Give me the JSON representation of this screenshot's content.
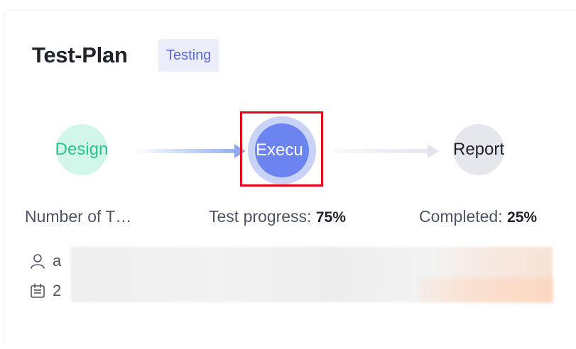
{
  "plan": {
    "title": "Test-Plan",
    "status_badge": "Testing"
  },
  "stages": [
    {
      "label": "Design",
      "color": "#2ec38b"
    },
    {
      "label": "Execu",
      "color": "#6c84f0"
    },
    {
      "label": "Report",
      "color": "#1f2329"
    }
  ],
  "stats": {
    "number_label": "Number of T…",
    "progress_label": "Test progress: ",
    "progress_value": "75%",
    "completed_label": "Completed: ",
    "completed_value": "25%"
  },
  "meta": {
    "user_text": "a",
    "date_text": "2"
  },
  "icons": {
    "user": "person-icon",
    "date": "calendar-icon"
  },
  "colors": {
    "accent": "#5767d6",
    "highlight": "#e3001b"
  }
}
